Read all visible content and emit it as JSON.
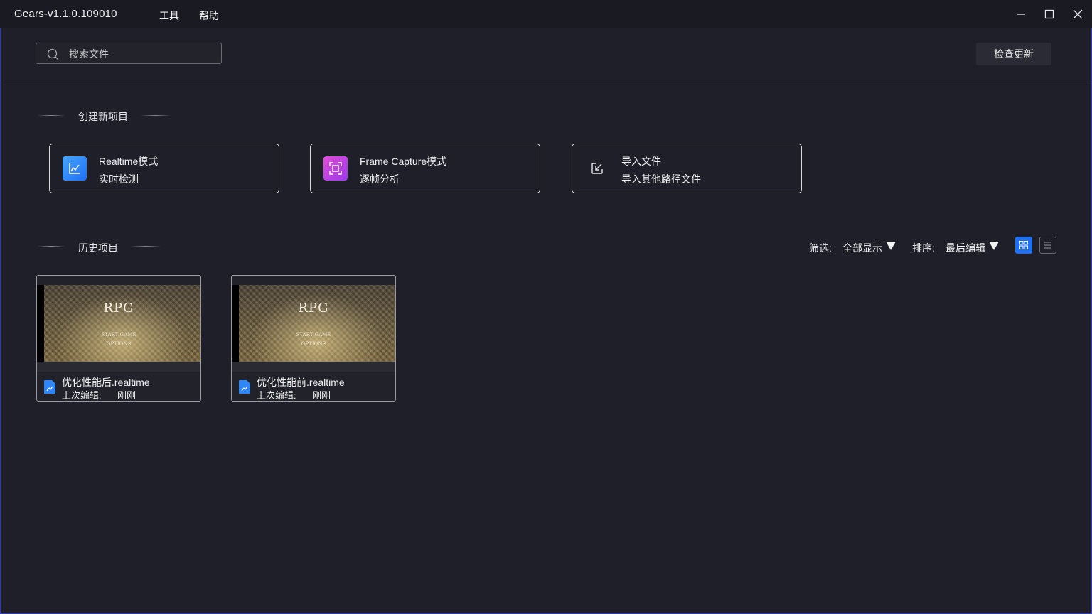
{
  "window": {
    "title": "Gears-v1.1.0.109010",
    "menu": [
      "工具",
      "帮助"
    ]
  },
  "search": {
    "placeholder": "搜索文件",
    "value": ""
  },
  "header": {
    "update_button": "检查更新"
  },
  "create_section": {
    "title": "创建新项目",
    "cards": [
      {
        "title": "Realtime模式",
        "subtitle": "实时检测",
        "icon": "chart-icon",
        "color": "#2f86f6"
      },
      {
        "title": "Frame Capture模式",
        "subtitle": "逐帧分析",
        "icon": "frame-capture-icon",
        "color": "#c53fdc"
      },
      {
        "title": "导入文件",
        "subtitle": "导入其他路径文件",
        "icon": "import-icon",
        "color": ""
      }
    ]
  },
  "history_section": {
    "title": "历史项目",
    "filter_label": "筛选:",
    "filter_value": "全部显示",
    "sort_label": "排序:",
    "sort_value": "最后编辑",
    "view_modes": [
      "grid",
      "list"
    ],
    "active_view": "grid"
  },
  "projects": [
    {
      "name": "优化性能后.realtime",
      "edited_label": "上次编辑:",
      "edited_value": "刚刚",
      "thumb_logo": "RPG",
      "thumb_line1": "START GAME",
      "thumb_line2": "OPTIONS"
    },
    {
      "name": "优化性能前.realtime",
      "edited_label": "上次编辑:",
      "edited_value": "刚刚",
      "thumb_logo": "RPG",
      "thumb_line1": "START GAME",
      "thumb_line2": "OPTIONS"
    }
  ],
  "colors": {
    "background": "#1f1f29",
    "accent": "#1f6ff2",
    "card_border": "#d9d9de"
  }
}
